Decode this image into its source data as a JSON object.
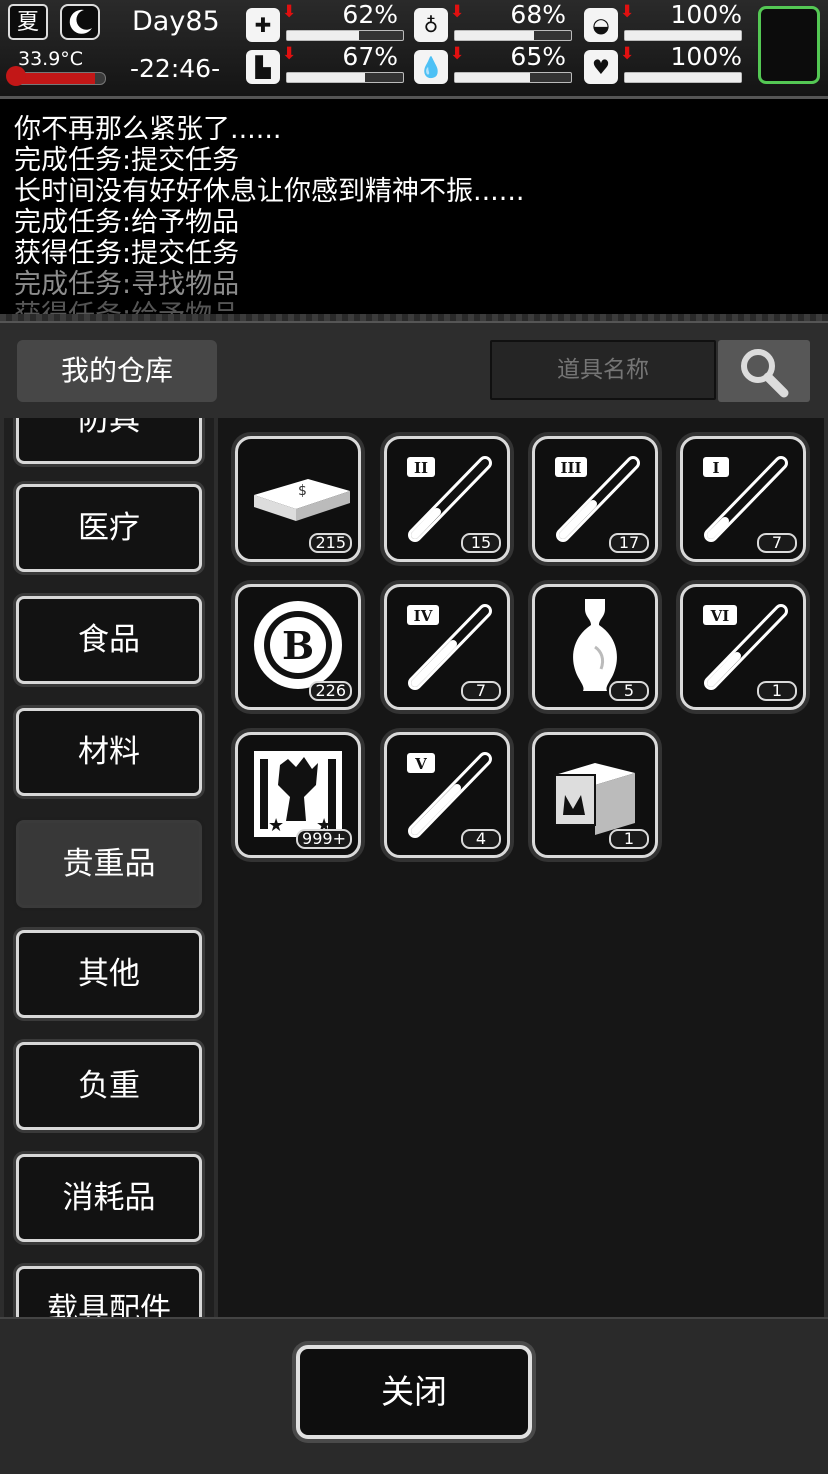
{
  "hud": {
    "season": "夏",
    "moon_icon": "moon-icon",
    "temperature": "33.9°C",
    "temperature_level": 0.9,
    "day": "Day85",
    "time": "-22:46-",
    "stats": [
      {
        "name": "health",
        "icon": "medkit-icon",
        "percent": "62%",
        "value": 0.62
      },
      {
        "name": "hunger",
        "icon": "stomach-icon",
        "percent": "68%",
        "value": 0.68
      },
      {
        "name": "pill",
        "icon": "pill-icon",
        "percent": "100%",
        "value": 1.0
      },
      {
        "name": "stamina",
        "icon": "foot-icon",
        "percent": "67%",
        "value": 0.67
      },
      {
        "name": "thirst",
        "icon": "water-drop-icon",
        "percent": "65%",
        "value": 0.65
      },
      {
        "name": "mood",
        "icon": "heart-icon",
        "percent": "100%",
        "value": 1.0
      }
    ],
    "accent_green": "#54c854",
    "alert_red": "#e01010"
  },
  "log": {
    "lines": [
      "你不再那么紧张了......",
      "完成任务:提交任务",
      "长时间没有好好休息让你感到精神不振......",
      "完成任务:给予物品",
      "获得任务:提交任务",
      "完成任务:寻找物品",
      "获得任务:给予物品"
    ]
  },
  "warehouse": {
    "title": "我的仓库",
    "search_placeholder": "道具名称",
    "categories": [
      "防具",
      "医疗",
      "食品",
      "材料",
      "贵重品",
      "其他",
      "负重",
      "消耗品",
      "载具配件"
    ],
    "active_category": "贵重品",
    "items": [
      {
        "icon": "cash-bundle-icon",
        "count": "215"
      },
      {
        "icon": "test-tube-ii-icon",
        "label": "II",
        "count": "15"
      },
      {
        "icon": "test-tube-iii-icon",
        "label": "III",
        "count": "17"
      },
      {
        "icon": "test-tube-i-icon",
        "label": "I",
        "count": "7"
      },
      {
        "icon": "b-coin-icon",
        "label": "B",
        "count": "226"
      },
      {
        "icon": "test-tube-iv-icon",
        "label": "IV",
        "count": "7"
      },
      {
        "icon": "vase-icon",
        "count": "5"
      },
      {
        "icon": "test-tube-vi-icon",
        "label": "VI",
        "count": "1"
      },
      {
        "icon": "zombie-card-icon",
        "count": "999+"
      },
      {
        "icon": "test-tube-v-icon",
        "label": "V",
        "count": "4"
      },
      {
        "icon": "chest-icon",
        "count": "1"
      }
    ]
  },
  "footer": {
    "close_label": "关闭"
  }
}
